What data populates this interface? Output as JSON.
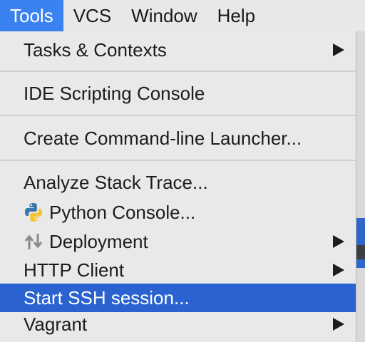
{
  "menubar": {
    "items": [
      {
        "label": "Tools",
        "active": true
      },
      {
        "label": "VCS",
        "active": false
      },
      {
        "label": "Window",
        "active": false
      },
      {
        "label": "Help",
        "active": false
      }
    ]
  },
  "menu": {
    "items": [
      {
        "label": "Tasks & Contexts",
        "submenu": true
      },
      {
        "label": "IDE Scripting Console",
        "submenu": false
      },
      {
        "label": "Create Command-line Launcher...",
        "submenu": false
      },
      {
        "label": "Analyze Stack Trace...",
        "submenu": false
      },
      {
        "label": "Python Console...",
        "submenu": false,
        "icon": "python-icon"
      },
      {
        "label": "Deployment",
        "submenu": true,
        "icon": "deployment-arrows-icon"
      },
      {
        "label": "HTTP Client",
        "submenu": true
      },
      {
        "label": "Start SSH session...",
        "submenu": false,
        "selected": true
      },
      {
        "label": "Vagrant",
        "submenu": true
      }
    ]
  },
  "colors": {
    "menubar_active": "#3a82f0",
    "selection": "#2a63cf",
    "menu_background": "#e9e9e9"
  }
}
